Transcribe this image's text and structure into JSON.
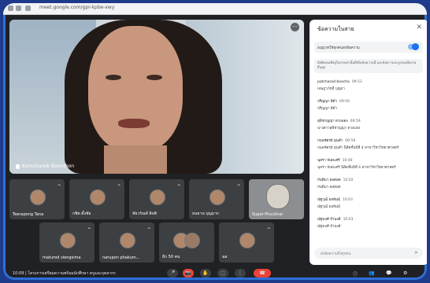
{
  "browser": {
    "url": "meet.google.com/gpr-kpbe-xwy"
  },
  "main_speaker": {
    "name": "Kornchanok Boonthon",
    "more_label": "···"
  },
  "tiles": [
    {
      "name": "Teerapong Tana"
    },
    {
      "name": "กชิต ตั้งชัย"
    },
    {
      "name": "ชัยวรัณท์ ลิขสิ"
    },
    {
      "name": "ธนธาน บุญมาก"
    },
    {
      "name": "Supot Phuckhar"
    },
    {
      "name": "maturod viengsima"
    },
    {
      "name": "narupon phakum..."
    },
    {
      "name": "อีก 50 คน"
    },
    {
      "name": "ฉล"
    }
  ],
  "chat": {
    "title": "ข้อความในสาย",
    "close": "✕",
    "toggle_label": "อนุญาตให้ทุกคนส่งข้อความ",
    "notice": "มีเพียงคนที่อยู่ในสายเท่านั้นที่เห็นข้อความนี้ และข้อความจะถูกลบเมื่อสายสิ้นสุด",
    "messages": [
      {
        "sender": "patcharad boocha",
        "time": "09:53",
        "text": "เจษฎาภักดิ์ บุญมา"
      },
      {
        "sender": "ปริญญา ยีดำ",
        "time": "09:56",
        "text": "ปริญญา ยีดำ"
      },
      {
        "sender": "สุพิชาญญา ดวงแดง",
        "time": "09:59",
        "text": "นางสาวสุพิชาญญา ดวงแดง"
      },
      {
        "sender": "กมลชัตรย์ อุ่นคำ",
        "time": "09:59",
        "text": "กมลชัตรย์ อุ่นคำ นิสิตชั้นปีที่ 4 สาขาวิชาวิทยาศาสตร์"
      },
      {
        "sender": "นุสรา จันทะศรี",
        "time": "10:00",
        "text": "นุสรา จันทะศรี นิสิตชั้นปีที่ 4 สาขาวิชาวิทยาศาสตร์"
      },
      {
        "sender": "กันติมา ผลต่อต",
        "time": "10:02",
        "text": "กันติมา ผลต่อต"
      },
      {
        "sender": "ณัฐวุฒิ ผลพันธุ์",
        "time": "10:03",
        "text": "ณัฐวุฒิ ผลพันธุ์"
      },
      {
        "sender": "ณัฐพงศ์ จำนงค์",
        "time": "10:03",
        "text": "ณัฐพงศ์ จำนงค์"
      }
    ],
    "compose_placeholder": "ส่งข้อความถึงทุกคน",
    "send": "➤"
  },
  "bottom_bar": {
    "time": "10:09",
    "meeting": "โครงการเตรียมความพร้อมนักศึกษา ครูและบุคลากร",
    "controls": [
      "🎤",
      "📷",
      "✋",
      "⬚",
      "⋮",
      "☎"
    ],
    "right": [
      "ⓘ",
      "👥",
      "💬",
      "⚙"
    ]
  }
}
